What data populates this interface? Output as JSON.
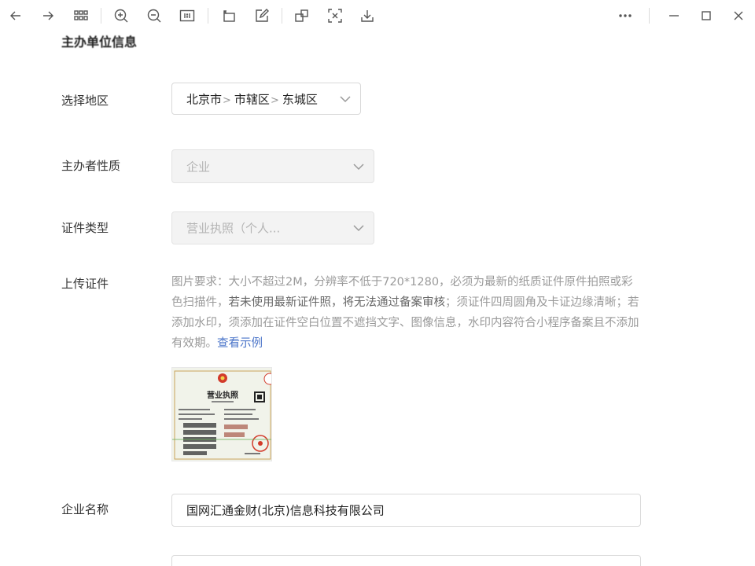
{
  "toolbar": {
    "buttons": [
      {
        "name": "back-icon"
      },
      {
        "name": "forward-icon"
      },
      {
        "name": "grid-icon"
      },
      {
        "name": "zoom-in-icon"
      },
      {
        "name": "zoom-out-icon"
      },
      {
        "name": "actual-size-icon"
      },
      {
        "name": "rotate-icon"
      },
      {
        "name": "edit-icon"
      },
      {
        "name": "crop-icon"
      },
      {
        "name": "ocr-icon"
      },
      {
        "name": "download-icon"
      },
      {
        "name": "more-icon"
      },
      {
        "name": "minimize-icon"
      },
      {
        "name": "maximize-icon"
      },
      {
        "name": "close-icon"
      }
    ],
    "actual_size_label": "1:1"
  },
  "form": {
    "section_title": "主办单位信息",
    "region": {
      "label": "选择地区",
      "parts": [
        "北京市",
        "市辖区",
        "东城区"
      ]
    },
    "organizer_type": {
      "label": "主办者性质",
      "value": "企业"
    },
    "cert_type": {
      "label": "证件类型",
      "value": "营业执照（个人..."
    },
    "upload": {
      "label": "上传证件",
      "desc_1": "图片要求：大小不超过2M，分辨率不低于720*1280，必须为最新的纸质证件原件拍照或彩色扫描件，",
      "desc_em": "若未使用最新证件照，将无法通过备案审核",
      "desc_2": "；须证件四周圆角及卡证边缘清晰；若添加水印，须添加在证件空白位置不遮挡文字、图像信息，水印内容符合小程序备案且不添加有效期。",
      "example_link": "查看示例",
      "license_title": "营业执照"
    },
    "company_name": {
      "label": "企业名称",
      "value": "国网汇通金财(北京)信息科技有限公司"
    }
  },
  "colors": {
    "link": "#4a74c9",
    "seal": "#d23a2a",
    "border": "#d9d9d9"
  }
}
